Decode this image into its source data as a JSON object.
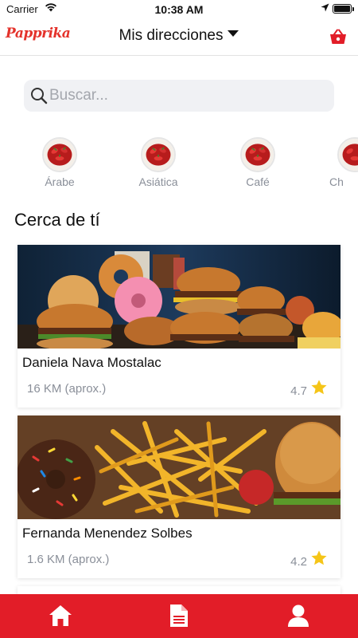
{
  "status_bar": {
    "carrier": "Carrier",
    "time": "10:38 AM"
  },
  "header": {
    "logo": "Papprika",
    "title": "Mis direcciones",
    "cart_icon": "basket-icon"
  },
  "search": {
    "placeholder": "Buscar..."
  },
  "categories": [
    {
      "label": "Árabe"
    },
    {
      "label": "Asiática"
    },
    {
      "label": "Café"
    },
    {
      "label": "Ch"
    }
  ],
  "section_title": "Cerca de tí",
  "restaurants": [
    {
      "name": "Daniela Nava Mostalac",
      "distance": "16 KM (aprox.)",
      "rating": "4.7"
    },
    {
      "name": "Fernanda Menendez Solbes",
      "distance": "1.6 KM (aprox.)",
      "rating": "4.2"
    }
  ],
  "tab_bar": {
    "items": [
      "home-icon",
      "orders-icon",
      "profile-icon"
    ]
  },
  "colors": {
    "brand": "#e21d28",
    "star": "#f5c518",
    "muted_text": "#8a8f99"
  }
}
